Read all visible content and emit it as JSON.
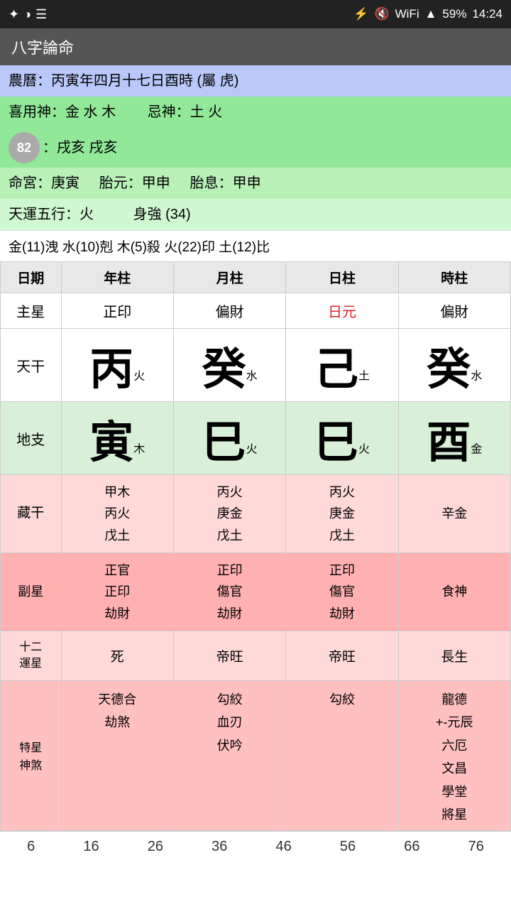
{
  "statusBar": {
    "time": "14:24",
    "battery": "59%",
    "icons": [
      "●",
      "◑",
      "☰"
    ]
  },
  "titleBar": {
    "title": "八字論命"
  },
  "lunarInfo": "農曆：丙寅年四月十七日酉時 (屬 虎)",
  "xiyong": "喜用神：金 水 木",
  "jishen": "忌神：土 火",
  "score": "82",
  "jieInfo": "：戌亥 戌亥",
  "mingGong": "命宮：庚寅",
  "taiYuan": "胎元：甲申",
  "taiXi": "胎息：甲申",
  "tianYun": "天運五行：火",
  "shenQiang": "身強 (34)",
  "elements": "金(11)洩  水(10)剋  木(5)殺  火(22)印  土(12)比",
  "tableHeaders": [
    "日期",
    "年柱",
    "月柱",
    "日柱",
    "時柱"
  ],
  "zhuxing": {
    "label": "主星",
    "year": "正印",
    "month": "偏財",
    "day": "日元",
    "hour": "偏財"
  },
  "tiangan": {
    "label": "天干",
    "year": {
      "char": "丙",
      "element": "火"
    },
    "month": {
      "char": "癸",
      "element": "水"
    },
    "day": {
      "char": "己",
      "element": "土"
    },
    "hour": {
      "char": "癸",
      "element": "水"
    }
  },
  "dizhi": {
    "label": "地支",
    "year": {
      "char": "寅",
      "element": "木"
    },
    "month": {
      "char": "巳",
      "element": "火"
    },
    "day": {
      "char": "巳",
      "element": "火"
    },
    "hour": {
      "char": "酉",
      "element": "金"
    }
  },
  "zanggan": {
    "label": "藏干",
    "year": "甲木\n丙火\n戊土",
    "month": "丙火\n庚金\n戊土",
    "day": "丙火\n庚金\n戊土",
    "hour": "辛金"
  },
  "fuxing": {
    "label": "副星",
    "year": "正官\n正印\n劫財",
    "month": "正印\n傷官\n劫財",
    "day": "正印\n傷官\n劫財",
    "hour": "食神"
  },
  "yunxing": {
    "label": "十二\n運星",
    "year": "死",
    "month": "帝旺",
    "day": "帝旺",
    "hour": "長生"
  },
  "texing": {
    "label": "特星\n神煞",
    "year": "天德合\n劫煞",
    "month": "勾絞\n血刃\n伏吟",
    "day": "勾絞",
    "hour": "龍德\n+-元辰\n六厄\n文昌\n學堂\n將星"
  },
  "footerNums": [
    "6",
    "16",
    "26",
    "36",
    "46",
    "56",
    "66",
    "76"
  ]
}
